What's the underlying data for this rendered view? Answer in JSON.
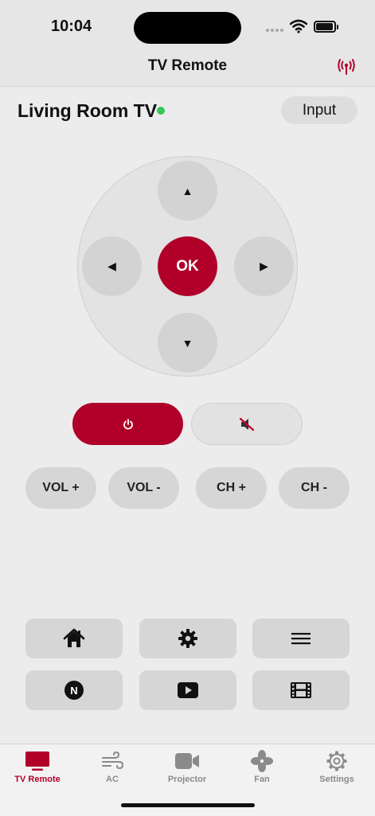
{
  "status_bar": {
    "time": "10:04"
  },
  "header": {
    "title": "TV Remote"
  },
  "device": {
    "name": "Living Room TV",
    "input_label": "Input"
  },
  "dpad": {
    "ok_label": "OK",
    "up_glyph": "▲",
    "down_glyph": "▼",
    "left_glyph": "◀",
    "right_glyph": "▶"
  },
  "volume": [
    {
      "label": "VOL +"
    },
    {
      "label": "VOL -"
    },
    {
      "label": "CH +"
    },
    {
      "label": "CH -"
    }
  ],
  "grid_buttons": [
    {
      "icon": "home-icon"
    },
    {
      "icon": "gear-icon"
    },
    {
      "icon": "menu-icon"
    },
    {
      "icon": "netflix-icon",
      "text": "N"
    },
    {
      "icon": "play-icon"
    },
    {
      "icon": "film-icon"
    }
  ],
  "tabs": [
    {
      "label": "TV Remote",
      "icon": "tv-icon",
      "active": true
    },
    {
      "label": "AC",
      "icon": "wind-icon",
      "active": false
    },
    {
      "label": "Projector",
      "icon": "video-camera-icon",
      "active": false
    },
    {
      "label": "Fan",
      "icon": "fan-icon",
      "active": false
    },
    {
      "label": "Settings",
      "icon": "gear-icon",
      "active": false
    }
  ],
  "colors": {
    "accent": "#b0002a",
    "online": "#34c759",
    "button": "#d6d6d6",
    "background": "#ececec"
  }
}
